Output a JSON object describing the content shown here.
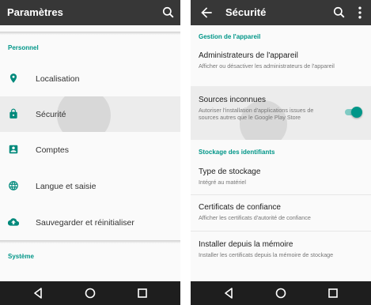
{
  "left": {
    "title": "Paramètres",
    "section_personal": "Personnel",
    "items": [
      {
        "label": "Localisation",
        "icon": "location-pin-icon"
      },
      {
        "label": "Sécurité",
        "icon": "lock-icon"
      },
      {
        "label": "Comptes",
        "icon": "account-box-icon"
      },
      {
        "label": "Langue et saisie",
        "icon": "globe-icon"
      },
      {
        "label": "Sauvegarder et réinitialiser",
        "icon": "cloud-upload-icon"
      }
    ],
    "section_system": "Système"
  },
  "right": {
    "title": "Sécurité",
    "section_device_admin": "Gestion de l'appareil",
    "device_admins": {
      "title": "Administrateurs de l'appareil",
      "summary": "Afficher ou désactiver les administrateurs de l'appareil"
    },
    "unknown_sources": {
      "title": "Sources inconnues",
      "summary": "Autoriser l'installation d'applications issues de sources autres que le Google Play Store",
      "enabled": true
    },
    "section_credentials": "Stockage des identifiants",
    "storage_type": {
      "title": "Type de stockage",
      "summary": "Intégré au matériel"
    },
    "trusted_certs": {
      "title": "Certificats de confiance",
      "summary": "Afficher les certificats d'autorité de confiance"
    },
    "install_from_storage": {
      "title": "Installer depuis la mémoire",
      "summary": "Installer les certificats depuis la mémoire de stockage"
    }
  },
  "colors": {
    "appbar": "#373737",
    "accent": "#009688",
    "navbar": "#1e1e1e",
    "icon": "#00897b"
  },
  "icons": {
    "search": "search-icon",
    "back": "back-arrow-icon",
    "more": "more-vert-icon",
    "nav_back": "nav-back-icon",
    "nav_home": "nav-home-icon",
    "nav_recents": "nav-recents-icon"
  }
}
